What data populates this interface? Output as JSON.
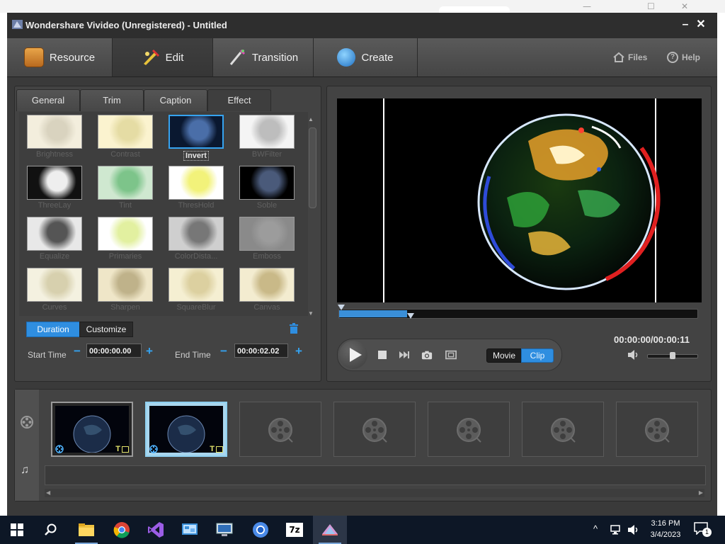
{
  "app": {
    "title": "Wondershare Vivideo (Unregistered) - Untitled",
    "minimize": "–",
    "close": "✕"
  },
  "background_window": {
    "minimize": "—",
    "maximize": "☐",
    "close": "✕"
  },
  "nav": {
    "tabs": [
      {
        "label": "Resource",
        "icon": "resource-icon",
        "active": false
      },
      {
        "label": "Edit",
        "icon": "edit-icon",
        "active": true
      },
      {
        "label": "Transition",
        "icon": "transition-icon",
        "active": false
      },
      {
        "label": "Create",
        "icon": "create-icon",
        "active": false
      }
    ],
    "files": "Files",
    "help": "Help",
    "help_glyph": "?"
  },
  "edit_tabs": [
    {
      "label": "General",
      "active": false
    },
    {
      "label": "Trim",
      "active": false
    },
    {
      "label": "Caption",
      "active": false
    },
    {
      "label": "Effect",
      "active": true
    }
  ],
  "effects": [
    {
      "label": "Brightness"
    },
    {
      "label": "Contrast"
    },
    {
      "label": "Invert",
      "selected": true
    },
    {
      "label": "BWFilter"
    },
    {
      "label": "ThreeLay"
    },
    {
      "label": "Tint"
    },
    {
      "label": "ThresHold"
    },
    {
      "label": "Soble"
    },
    {
      "label": "Equalize"
    },
    {
      "label": "Primaries"
    },
    {
      "label": "ColorDista..."
    },
    {
      "label": "Emboss"
    },
    {
      "label": "Curves"
    },
    {
      "label": "Sharpen"
    },
    {
      "label": "SquareBlur"
    },
    {
      "label": "Canvas"
    }
  ],
  "duration_controls": {
    "duration_label": "Duration",
    "customize_label": "Customize",
    "start_label": "Start Time",
    "start_value": "00:00:00.00",
    "end_label": "End Time",
    "end_value": "00:00:02.02",
    "minus": "−",
    "plus": "+"
  },
  "preview": {
    "time": "00:00:00/00:00:11",
    "movie_label": "Movie",
    "clip_label": "Clip",
    "seek_progress": 0.19,
    "volume_level": 0.5
  },
  "timeline": {
    "clip_badge": "T",
    "music_glyph": "♫",
    "clips": [
      {
        "filled": true,
        "selected": false
      },
      {
        "filled": true,
        "selected": true
      },
      {
        "filled": false
      },
      {
        "filled": false
      },
      {
        "filled": false
      },
      {
        "filled": false
      },
      {
        "filled": false
      }
    ]
  },
  "taskbar": {
    "time": "3:16 PM",
    "date": "3/4/2023",
    "notification_count": "1",
    "sevenzip_label": "7z",
    "apps": [
      "start-icon",
      "search-icon",
      "file-explorer-icon",
      "chrome-icon",
      "visual-studio-icon",
      "control-panel-icon",
      "remote-desktop-icon",
      "chromium-icon",
      "7zip-icon",
      "vivideo-icon"
    ]
  },
  "colors": {
    "accent": "#2f8ee0",
    "selection_border": "#35a3f0",
    "taskbar": "#0d1726"
  }
}
